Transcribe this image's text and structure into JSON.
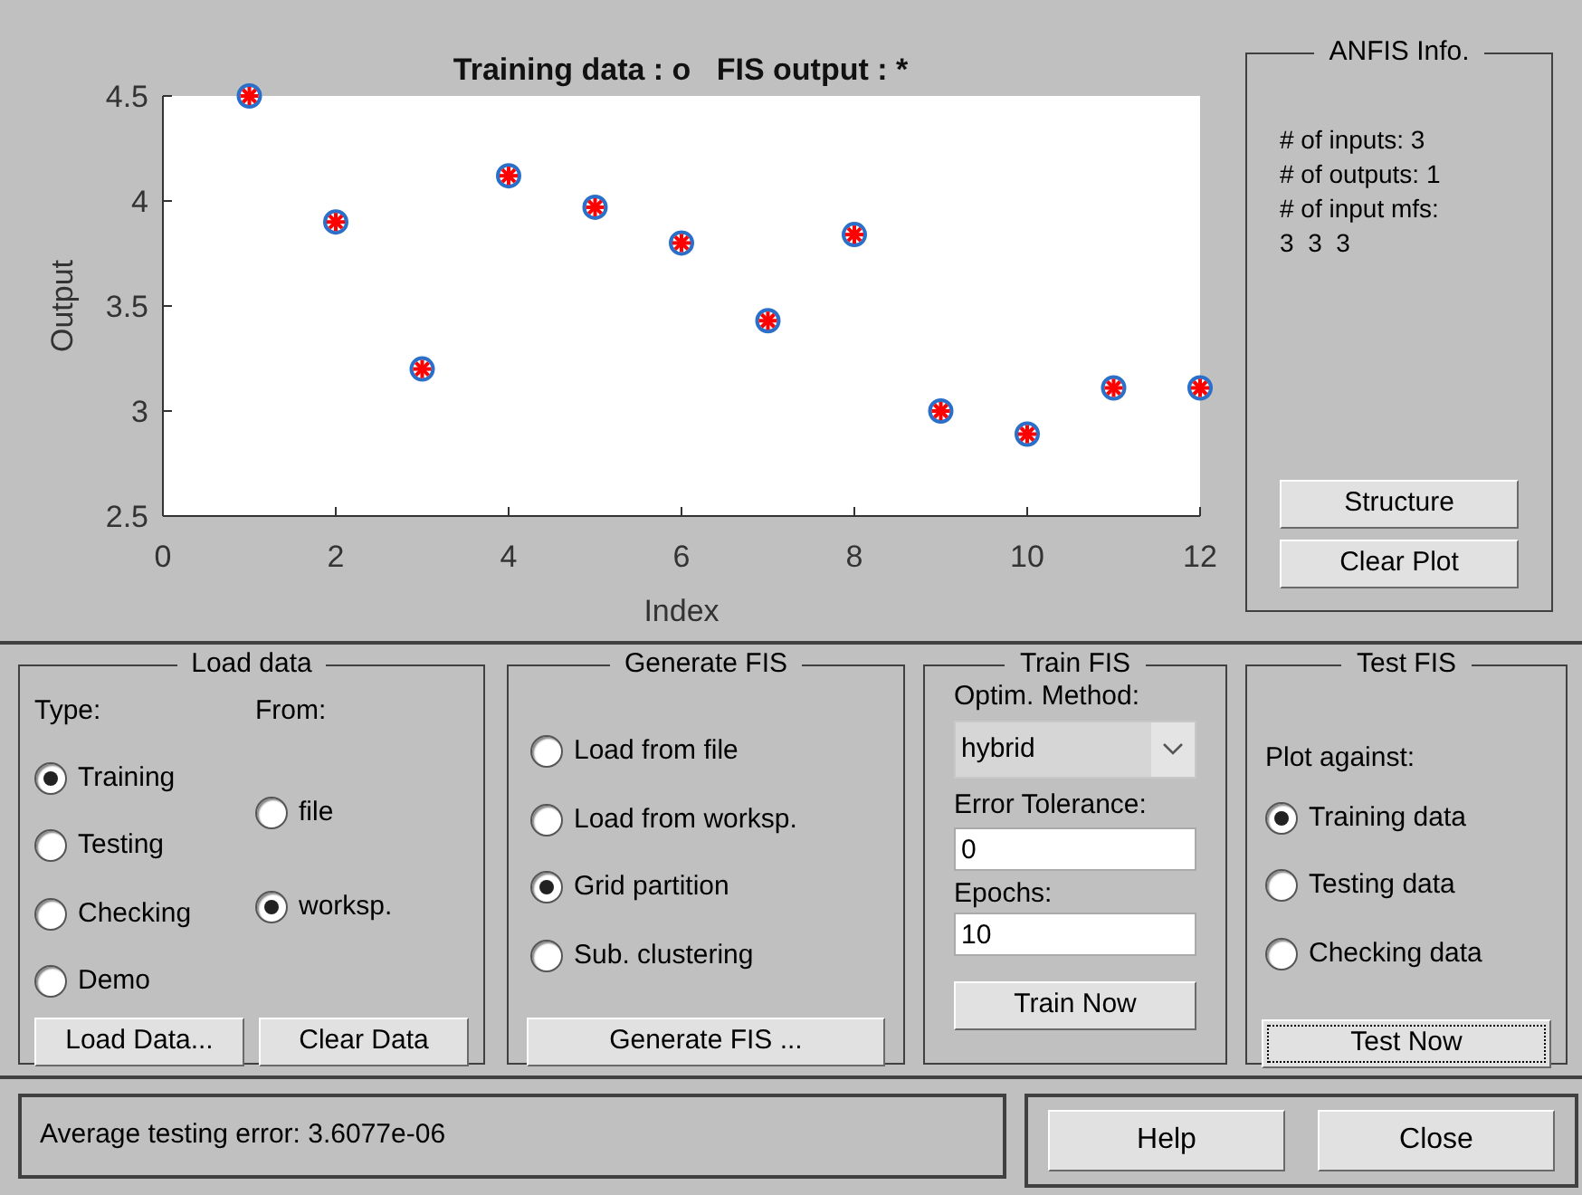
{
  "plot": {
    "chart_data": {
      "type": "scatter",
      "title": "Training data : o   FIS output : *",
      "xlabel": "Index",
      "ylabel": "Output",
      "x": [
        1,
        2,
        3,
        4,
        5,
        6,
        7,
        8,
        9,
        10,
        11,
        12
      ],
      "series": [
        {
          "color": "#2a6fc9",
          "values": [
            4.5,
            3.9,
            3.2,
            4.12,
            3.97,
            3.8,
            3.43,
            3.84,
            3.0,
            2.89,
            3.11,
            3.11
          ]
        },
        {
          "color": "#ff0000",
          "values": [
            4.5,
            3.9,
            3.2,
            4.12,
            3.97,
            3.8,
            3.43,
            3.84,
            3.0,
            2.89,
            3.11,
            3.11
          ]
        }
      ],
      "xlim": [
        0,
        12
      ],
      "ylim": [
        2.5,
        4.5
      ],
      "xticks": [
        0,
        2,
        4,
        6,
        8,
        10,
        12
      ],
      "yticks": [
        2.5,
        3,
        3.5,
        4,
        4.5
      ]
    }
  },
  "anfis_info": {
    "title": "ANFIS Info.",
    "lines": [
      "# of inputs: 3",
      "# of outputs: 1",
      "# of input mfs:",
      "3  3  3"
    ],
    "buttons": [
      {
        "label": "Structure",
        "focused": false
      },
      {
        "label": "Clear Plot",
        "focused": false
      }
    ]
  },
  "load_data": {
    "title": "Load data",
    "type_label": "Type:",
    "type_options": [
      {
        "label": "Training",
        "selected": true
      },
      {
        "label": "Testing",
        "selected": false
      },
      {
        "label": "Checking",
        "selected": false
      },
      {
        "label": "Demo",
        "selected": false
      }
    ],
    "from_label": "From:",
    "from_options": [
      {
        "label": "file",
        "selected": false
      },
      {
        "label": "worksp.",
        "selected": true
      }
    ],
    "buttons": [
      {
        "label": "Load Data...",
        "focused": false
      },
      {
        "label": "Clear Data",
        "focused": false
      }
    ]
  },
  "generate_fis": {
    "title": "Generate FIS",
    "options": [
      {
        "label": "Load from file",
        "selected": false
      },
      {
        "label": "Load from worksp.",
        "selected": false
      },
      {
        "label": "Grid partition",
        "selected": true
      },
      {
        "label": "Sub. clustering",
        "selected": false
      }
    ],
    "button": {
      "label": "Generate FIS ...",
      "focused": false
    }
  },
  "train_fis": {
    "title": "Train FIS",
    "method_label": "Optim. Method:",
    "method_value": "hybrid",
    "tolerance_label": "Error Tolerance:",
    "tolerance_value": "0",
    "epochs_label": "Epochs:",
    "epochs_value": "10",
    "button": {
      "label": "Train Now",
      "focused": false
    }
  },
  "test_fis": {
    "title": "Test FIS",
    "plot_against_label": "Plot against:",
    "options": [
      {
        "label": "Training data",
        "selected": true
      },
      {
        "label": "Testing data",
        "selected": false
      },
      {
        "label": "Checking data",
        "selected": false
      }
    ],
    "button": {
      "label": "Test Now",
      "focused": true
    }
  },
  "status": {
    "text": "Average testing error: 3.6077e-06"
  },
  "footer_buttons": [
    {
      "label": "Help",
      "focused": false
    },
    {
      "label": "Close",
      "focused": false
    }
  ]
}
